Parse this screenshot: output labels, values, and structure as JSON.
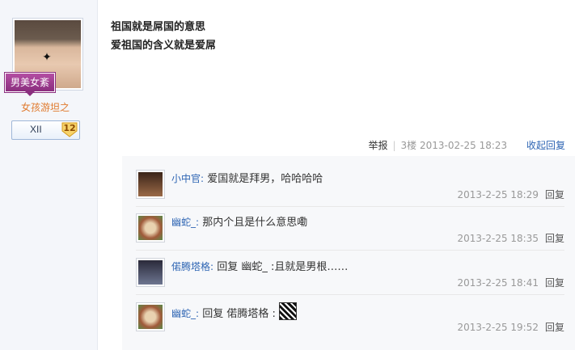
{
  "author": {
    "title_badge": "男美女紊",
    "username": "女孩游坦之",
    "level_name": "XII",
    "level_number": "12",
    "butterfly_glyph": "🦋"
  },
  "post": {
    "lines": [
      "祖国就是屌国的意思",
      "爱祖国的含义就是爱屌"
    ],
    "report": "举报",
    "floor": "3楼",
    "time": "2013-02-25 18:23",
    "collapse": "收起回复"
  },
  "replies": [
    {
      "name": "小中官:",
      "text": "爱国就是拜男，哈哈哈哈",
      "time": "2013-2-25 18:29",
      "reply": "回复",
      "avatar_color": "#7a4a30"
    },
    {
      "name": "幽蛇_:",
      "text": "那内个且是什么意思嘞",
      "time": "2013-2-25 18:35",
      "reply": "回复",
      "avatar_color": "#c9a07a"
    },
    {
      "name": "偌腾塔格:",
      "text": "回复  幽蛇_ :且就是男根……",
      "time": "2013-2-25 18:41",
      "reply": "回复",
      "avatar_color": "#3a3a4a"
    },
    {
      "name": "幽蛇_:",
      "text": "回复  偌腾塔格 :",
      "time": "2013-2-25 19:52",
      "reply": "回复",
      "avatar_color": "#c9a07a"
    }
  ]
}
